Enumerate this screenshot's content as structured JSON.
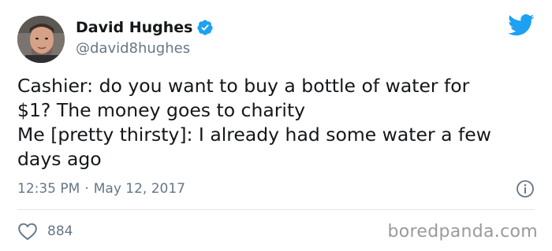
{
  "user": {
    "display_name": "David Hughes",
    "handle": "@david8hughes",
    "verified": true,
    "avatar_icon": "profile-photo"
  },
  "tweet": {
    "lines": [
      "Cashier: do you want to buy a bottle of water for",
      "$1? The money goes to charity",
      "Me [pretty thirsty]: I already had some water a few",
      "days ago"
    ],
    "time": "12:35 PM",
    "separator": "·",
    "date": "May 12, 2017",
    "likes": "884"
  },
  "icons": {
    "brand": "twitter-bird-icon",
    "verified": "verified-badge-icon",
    "info": "info-icon",
    "like": "heart-icon"
  },
  "colors": {
    "brand_blue": "#1da1f2",
    "secondary_text": "#657786",
    "primary_text": "#14171a"
  },
  "watermark": "boredpanda.com"
}
